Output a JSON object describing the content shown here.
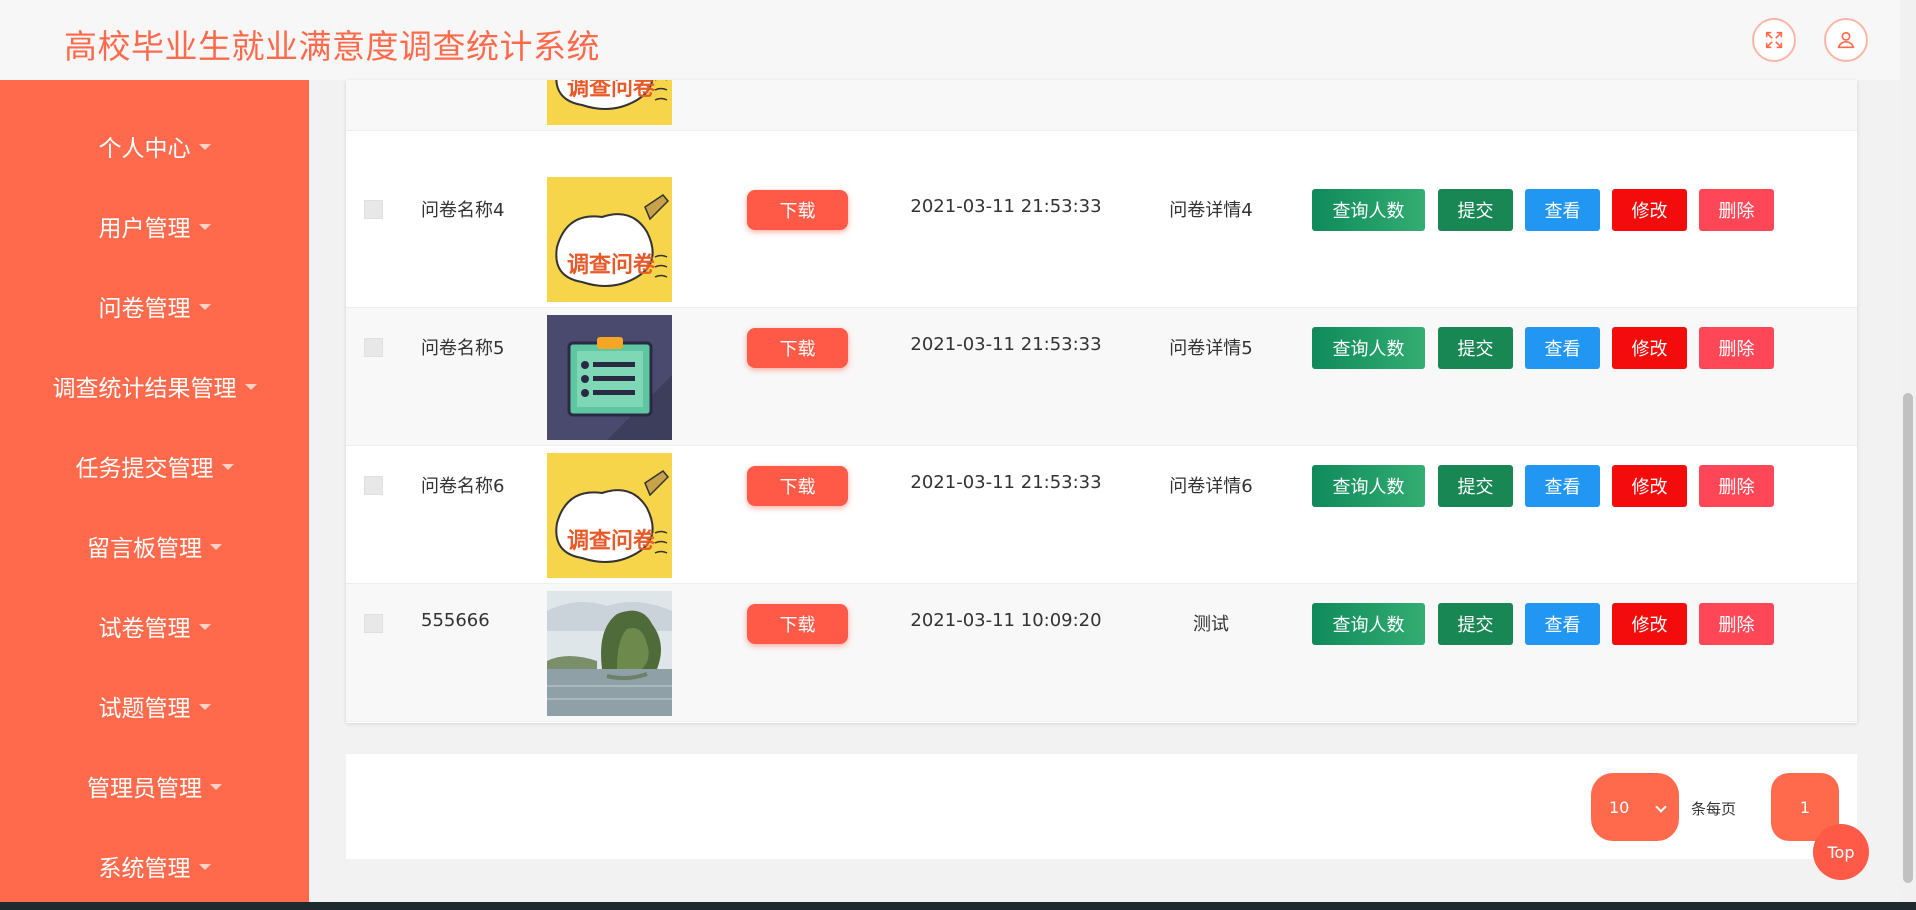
{
  "header": {
    "title": "高校毕业生就业满意度调查统计系统",
    "fullscreen_icon": "expand-icon",
    "user_icon": "user-icon",
    "accent_color": "#ff6a4d"
  },
  "sidebar": {
    "items": [
      {
        "label": "个人中心"
      },
      {
        "label": "用户管理"
      },
      {
        "label": "问卷管理"
      },
      {
        "label": "调查统计结果管理"
      },
      {
        "label": "任务提交管理"
      },
      {
        "label": "留言板管理"
      },
      {
        "label": "试卷管理"
      },
      {
        "label": "试题管理"
      },
      {
        "label": "管理员管理"
      },
      {
        "label": "系统管理"
      }
    ]
  },
  "table": {
    "rows": [
      {
        "name": "问卷名称4",
        "download": "下载",
        "time": "2021-03-11 21:53:33",
        "detail": "问卷详情4",
        "image": "survey-cartoon"
      },
      {
        "name": "问卷名称5",
        "download": "下载",
        "time": "2021-03-11 21:53:33",
        "detail": "问卷详情5",
        "image": "clipboard-board"
      },
      {
        "name": "问卷名称6",
        "download": "下载",
        "time": "2021-03-11 21:53:33",
        "detail": "问卷详情6",
        "image": "survey-cartoon"
      },
      {
        "name": "555666",
        "download": "下载",
        "time": "2021-03-11 10:09:20",
        "detail": "测试",
        "image": "landscape-photo"
      }
    ],
    "actions": {
      "query": "查询人数",
      "submit": "提交",
      "view": "查看",
      "edit": "修改",
      "delete": "删除"
    },
    "image_caption": "调查问卷"
  },
  "pagination": {
    "page_size": "10",
    "per_page_label": "条每页",
    "current_page": "1"
  },
  "top_button": "Top"
}
